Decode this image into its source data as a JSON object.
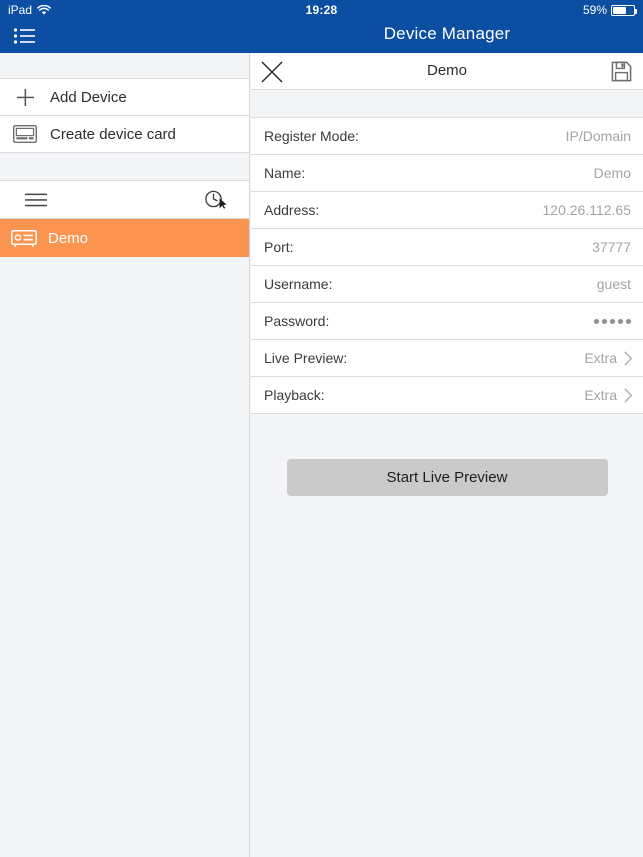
{
  "status_bar": {
    "device_label": "iPad",
    "wifi_icon": "wifi-icon",
    "time": "19:28",
    "battery_text": "59%",
    "battery_percent": 59
  },
  "nav_bar": {
    "menu_icon": "list-menu-icon",
    "title": "Device Manager",
    "background_color": "#0b4ea2"
  },
  "sidebar": {
    "actions": [
      {
        "icon": "plus-icon",
        "label": "Add Device"
      },
      {
        "icon": "device-card-icon",
        "label": "Create device card"
      }
    ],
    "group_row": {
      "menu_icon": "hamburger-icon",
      "history_icon": "clock-history-icon"
    },
    "devices": [
      {
        "icon": "dvr-device-icon",
        "label": "Demo",
        "selected": true,
        "highlight_color": "#fa9450"
      }
    ]
  },
  "detail": {
    "close_icon": "close-icon",
    "title": "Demo",
    "save_icon": "save-floppy-icon",
    "fields": [
      {
        "label": "Register Mode:",
        "value": "IP/Domain",
        "chevron": false
      },
      {
        "label": "Name:",
        "value": "Demo",
        "chevron": false
      },
      {
        "label": "Address:",
        "value": "120.26.112.65",
        "chevron": false
      },
      {
        "label": "Port:",
        "value": "37777",
        "chevron": false
      },
      {
        "label": "Username:",
        "value": "guest",
        "chevron": false
      },
      {
        "label": "Password:",
        "value": "",
        "masked": true,
        "mask_count": 5,
        "chevron": false
      },
      {
        "label": "Live Preview:",
        "value": "Extra",
        "chevron": true
      },
      {
        "label": "Playback:",
        "value": "Extra",
        "chevron": true
      }
    ],
    "primary_button": {
      "label": "Start Live Preview",
      "color": "#cacaca"
    }
  }
}
